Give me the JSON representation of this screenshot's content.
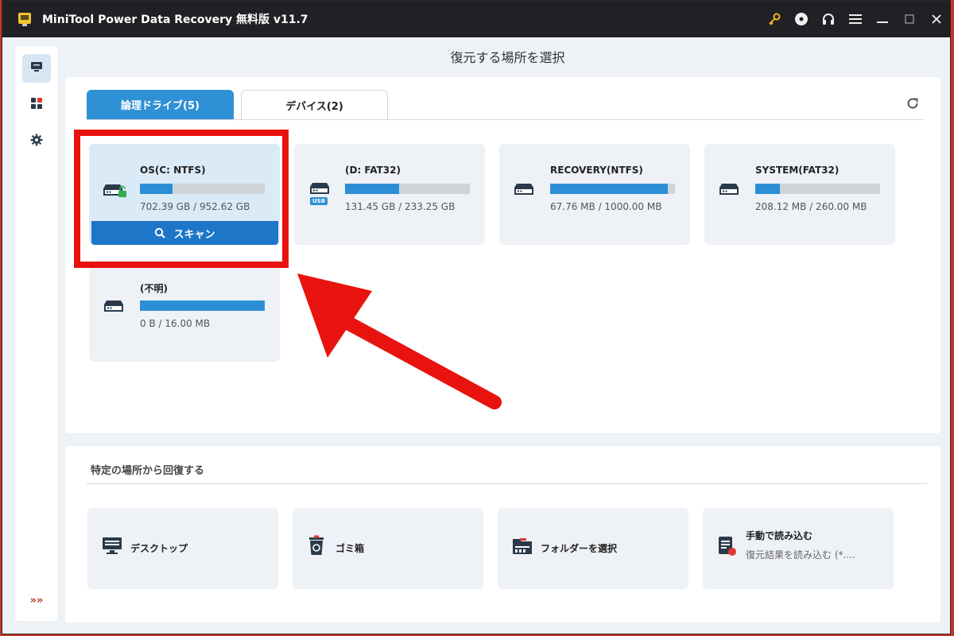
{
  "app": {
    "title": "MiniTool Power Data Recovery 無料版 v11.7"
  },
  "page_title": "復元する場所を選択",
  "tabs": [
    {
      "label": "論理ドライブ(5)",
      "active": true
    },
    {
      "label": "デバイス(2)",
      "active": false
    }
  ],
  "drives": [
    {
      "name": "OS(C: NTFS)",
      "size": "702.39 GB / 952.62 GB",
      "used_fraction": 0.26,
      "icon": "locked-drive-icon",
      "selected": true
    },
    {
      "name": "(D: FAT32)",
      "size": "131.45 GB / 233.25 GB",
      "used_fraction": 0.43,
      "icon": "usb-drive-icon",
      "usb_badge": "USB"
    },
    {
      "name": "RECOVERY(NTFS)",
      "size": "67.76 MB / 1000.00 MB",
      "used_fraction": 0.94,
      "icon": "drive-icon"
    },
    {
      "name": "SYSTEM(FAT32)",
      "size": "208.12 MB / 260.00 MB",
      "used_fraction": 0.2,
      "icon": "drive-icon"
    },
    {
      "name": "(不明)",
      "size": "0 B / 16.00 MB",
      "used_fraction": 1.0,
      "icon": "drive-icon"
    }
  ],
  "scan_button": {
    "label": "スキャン"
  },
  "specific_locations": {
    "title": "特定の場所から回復する",
    "items": [
      {
        "label": "デスクトップ",
        "icon": "desktop-icon"
      },
      {
        "label": "ゴミ箱",
        "icon": "recycle-bin-icon"
      },
      {
        "label": "フォルダーを選択",
        "icon": "folder-icon"
      },
      {
        "label": "手動で読み込む",
        "sub": "復元結果を読み込む (*....",
        "icon": "load-file-icon"
      }
    ]
  },
  "colors": {
    "accent": "#2f90d6",
    "scan_button": "#1d76c8",
    "highlight": "#e8130f",
    "titlebar": "#202124"
  },
  "sidebar": {
    "expand_label": "»»"
  }
}
